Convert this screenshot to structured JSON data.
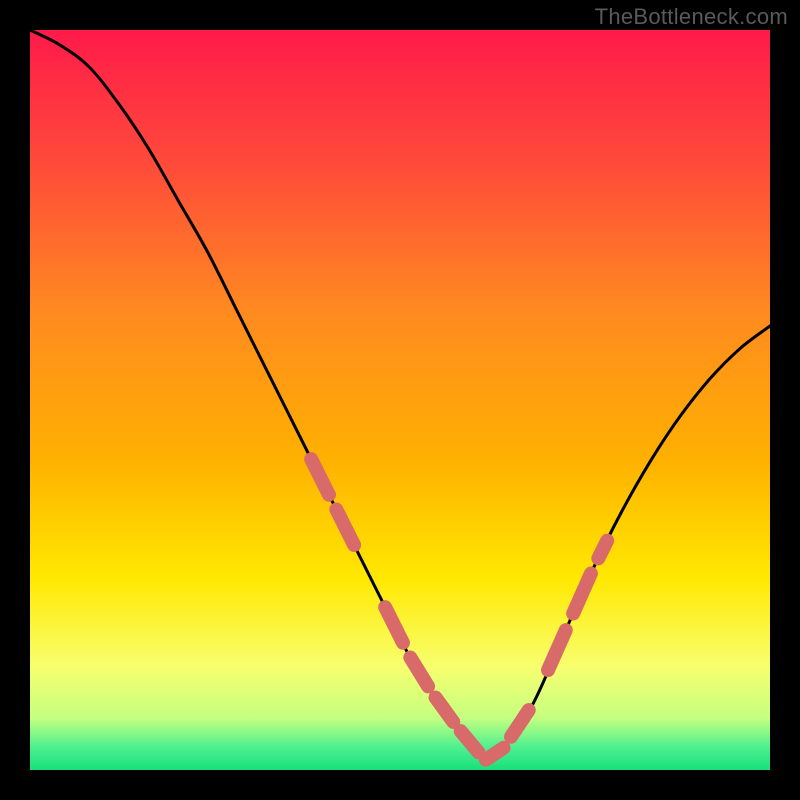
{
  "watermark": "TheBottleneck.com",
  "colors": {
    "background": "#000000",
    "curve": "#000000",
    "series_points": "#d86a6a",
    "gradient_top": "#ff1a4a",
    "gradient_mid1": "#ff6a2a",
    "gradient_mid2": "#ffb000",
    "gradient_mid3": "#ffe000",
    "gradient_bottom_yellow": "#f8ff6e",
    "gradient_band": "#c8ff78",
    "gradient_green": "#18e07a"
  },
  "chart_data": {
    "type": "line",
    "title": "",
    "xlabel": "",
    "ylabel": "",
    "xlim": [
      0,
      100
    ],
    "ylim": [
      0,
      100
    ],
    "grid": false,
    "legend": false,
    "series": [
      {
        "name": "bottleneck-curve",
        "x": [
          0,
          4,
          8,
          12,
          16,
          20,
          24,
          28,
          32,
          36,
          40,
          44,
          48,
          52,
          56,
          60,
          62,
          64,
          68,
          72,
          76,
          80,
          84,
          88,
          92,
          96,
          100
        ],
        "y": [
          100,
          98,
          95,
          90,
          84,
          77,
          70,
          62,
          54,
          46,
          38,
          30,
          22,
          14,
          8,
          3,
          1,
          3,
          9,
          18,
          27,
          35,
          42,
          48,
          53,
          57,
          60
        ]
      },
      {
        "name": "highlight-segments",
        "segments": [
          {
            "x_range": [
              38,
              44
            ],
            "y_range": [
              24,
              34
            ]
          },
          {
            "x_range": [
              48,
              68
            ],
            "y_range": [
              0,
              10
            ]
          },
          {
            "x_range": [
              70,
              78
            ],
            "y_range": [
              18,
              30
            ]
          }
        ]
      }
    ]
  }
}
